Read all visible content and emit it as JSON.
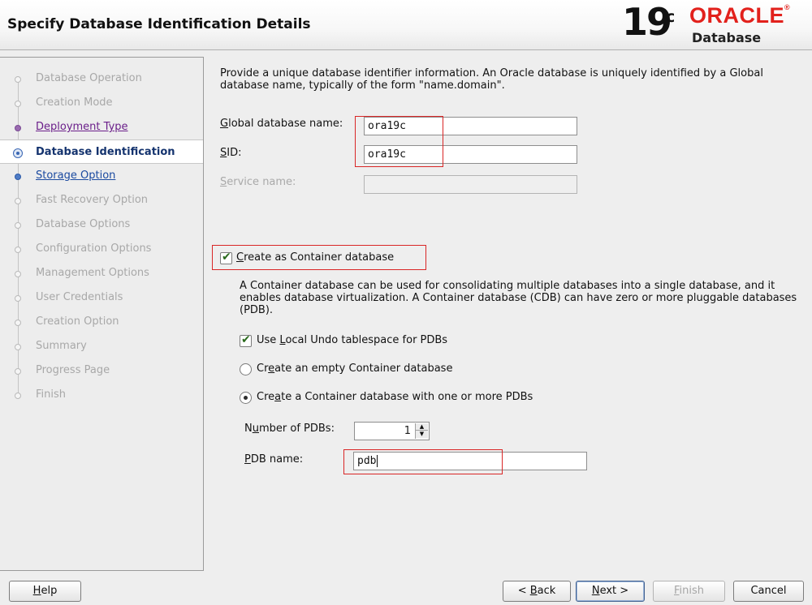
{
  "header": {
    "title": "Specify Database Identification Details",
    "logo": {
      "version": "19",
      "version_sup": "c",
      "brand": "ORACLE",
      "product": "Database"
    }
  },
  "sidebar": {
    "steps": [
      {
        "label": "Database Operation",
        "state": "disabled"
      },
      {
        "label": "Creation Mode",
        "state": "disabled"
      },
      {
        "label": "Deployment Type",
        "state": "visited"
      },
      {
        "label": "Database Identification",
        "state": "current"
      },
      {
        "label": "Storage Option",
        "state": "available"
      },
      {
        "label": "Fast Recovery Option",
        "state": "disabled"
      },
      {
        "label": "Database Options",
        "state": "disabled"
      },
      {
        "label": "Configuration Options",
        "state": "disabled"
      },
      {
        "label": "Management Options",
        "state": "disabled"
      },
      {
        "label": "User Credentials",
        "state": "disabled"
      },
      {
        "label": "Creation Option",
        "state": "disabled"
      },
      {
        "label": "Summary",
        "state": "disabled"
      },
      {
        "label": "Progress Page",
        "state": "disabled"
      },
      {
        "label": "Finish",
        "state": "disabled"
      }
    ]
  },
  "main": {
    "intro": "Provide a unique database identifier information. An Oracle database is uniquely identified by a Global database name, typically of the form \"name.domain\".",
    "global_db_name": {
      "label_key": "G",
      "label_rest": "lobal database name:",
      "value": "ora19c"
    },
    "sid": {
      "label_key": "S",
      "label_rest": "ID:",
      "value": "ora19c"
    },
    "service_name": {
      "label_key": "S",
      "label_rest": "ervice name:",
      "value": ""
    },
    "container": {
      "checkbox_key": "C",
      "checkbox_rest": "reate as Container database",
      "checked": true,
      "description": "A Container database can be used for consolidating multiple databases into a single database, and it enables database virtualization. A Container database (CDB) can have zero or more pluggable databases (PDB).",
      "local_undo": {
        "pre": "Use ",
        "key": "L",
        "post": "ocal Undo tablespace for PDBs",
        "checked": true
      },
      "empty_option": {
        "pre": "Cr",
        "key": "e",
        "post": "ate an empty Container database",
        "selected": false
      },
      "pdb_option": {
        "pre": "Cre",
        "key": "a",
        "post": "te a Container database with one or more PDBs",
        "selected": true
      },
      "num_pdbs": {
        "pre": "N",
        "key": "u",
        "post": "mber of PDBs:",
        "value": "1"
      },
      "pdb_name": {
        "pre": "",
        "key": "P",
        "post": "DB name:",
        "value": "pdb"
      }
    }
  },
  "footer": {
    "help": {
      "key": "H",
      "rest": "elp"
    },
    "back": {
      "pre": "< ",
      "key": "B",
      "post": "ack"
    },
    "next": {
      "pre": "",
      "key": "N",
      "post": "ext >"
    },
    "finish": {
      "pre": "",
      "key": "F",
      "post": "inish"
    },
    "cancel": "Cancel"
  },
  "colors": {
    "brand_red": "#e2211c",
    "highlight_box": "#d92626",
    "sidebar_active": "#14336e"
  }
}
